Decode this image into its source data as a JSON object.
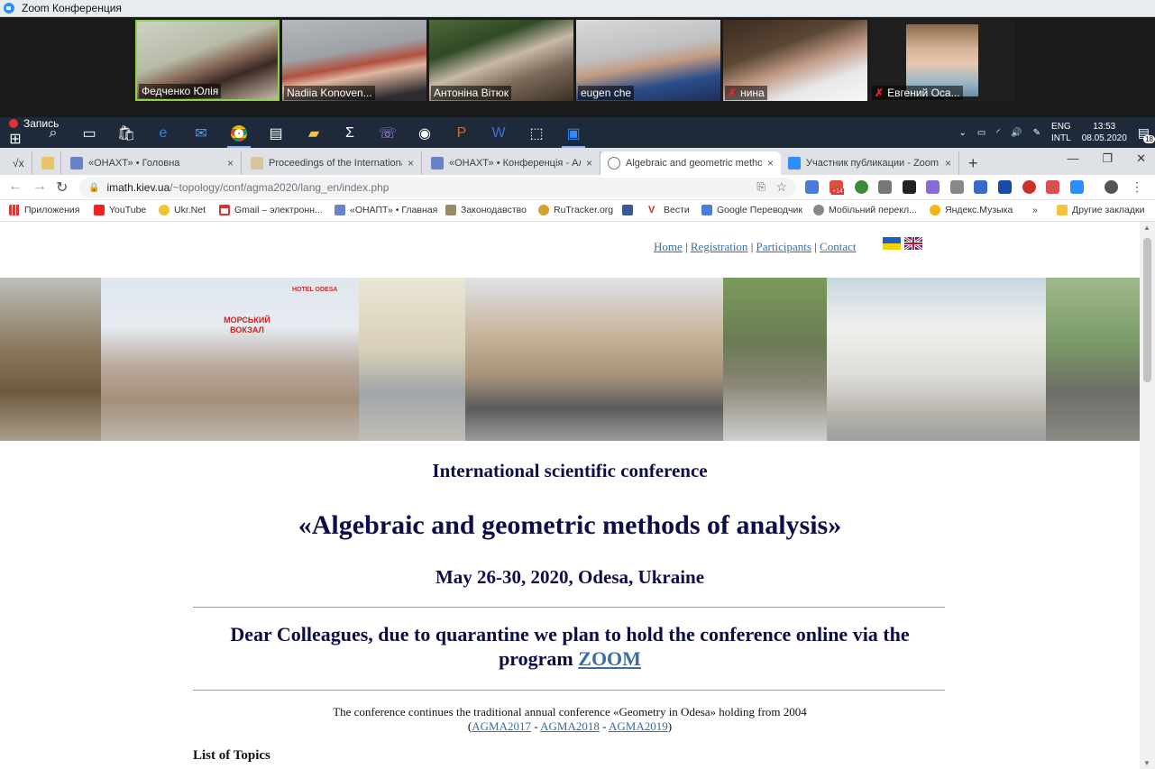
{
  "zoom": {
    "title": "Zoom Конференция",
    "participants": [
      {
        "name": "Федченко Юлія",
        "muted": false,
        "active": true
      },
      {
        "name": "Nadiia Konoven...",
        "muted": false,
        "active": false
      },
      {
        "name": "Антоніна Вітюк",
        "muted": false,
        "active": false
      },
      {
        "name": "eugen che",
        "muted": false,
        "active": false
      },
      {
        "name": "нина",
        "muted": true,
        "active": false
      },
      {
        "name": "Евгений Оса...",
        "muted": true,
        "active": false
      }
    ],
    "recording_label": "Запись"
  },
  "taskbar": {
    "lang_top": "ENG",
    "lang_bottom": "INTL",
    "time": "13:53",
    "date": "08.05.2020",
    "notifications": "18"
  },
  "browser": {
    "tabs": [
      {
        "label": "«ОНАХТ» • Головна",
        "close": "×"
      },
      {
        "label": "Proceedings of the International",
        "close": "×"
      },
      {
        "label": "«ОНАХТ» • Конференція - Алгеб",
        "close": "×"
      },
      {
        "label": "Algebraic and geometric methods",
        "close": "×"
      },
      {
        "label": "Участник публикации - Zoom",
        "close": "×"
      }
    ],
    "new_tab": "+",
    "url_host": "imath.kiev.ua",
    "url_path": "/~topology/conf/agma2020/lang_en/index.php",
    "ext_badge": "+14",
    "bookmarks": [
      "Приложения",
      "YouTube",
      "Ukr.Net",
      "Gmail – электронн...",
      "«ОНАПТ» • Главная",
      "Законодавство",
      "RuTracker.org",
      "",
      "Вести",
      "Google Переводчик",
      "Мобільний перекл...",
      "Яндекс.Музыка"
    ],
    "more_bookmarks": "»",
    "other_bookmarks": "Другие закладки"
  },
  "site": {
    "nav": [
      "Home",
      "Registration",
      "Participants",
      "Contact"
    ],
    "separator": " | ",
    "banner_sign": "МОРСЬКИЙ ВОКЗАЛ",
    "banner_hotel": "HOTEL ODESA",
    "subtitle": "International scientific conference",
    "title": "«Algebraic and geometric methods of analysis»",
    "dates": "May 26-30, 2020, Odesa, Ukraine",
    "notice_text": "Dear Colleagues, due to quarantine we plan to hold the conference online via the program",
    "notice_link": "ZOOM",
    "continues_text": "The conference continues the traditional annual conference «Geometry in Odesa» holding from 2004",
    "past": [
      "AGMA2017",
      "AGMA2018",
      "AGMA2019"
    ],
    "past_open": "(",
    "past_sep": " - ",
    "past_close": ")",
    "topics_heading": "List of Topics"
  }
}
